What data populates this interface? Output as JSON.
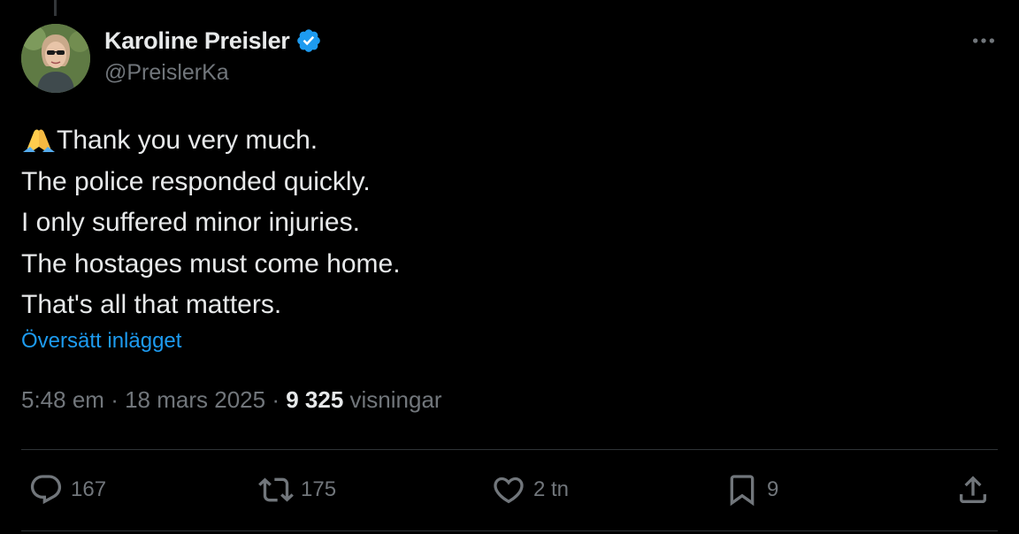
{
  "author": {
    "display_name": "Karoline Preisler",
    "handle": "@PreislerKa",
    "verified": true
  },
  "tweet": {
    "emoji": "folded-hands",
    "lines": [
      "Thank you very much.",
      "The police responded quickly.",
      "I only suffered minor injuries.",
      "The hostages must come home.",
      "That's all that matters."
    ],
    "translate_label": "Översätt inlägget"
  },
  "meta": {
    "time": "5:48 em",
    "separator": "·",
    "date": "18 mars 2025",
    "views_count": "9 325",
    "views_label": "visningar"
  },
  "actions": {
    "replies": "167",
    "reposts": "175",
    "likes": "2 tn",
    "bookmarks": "9"
  },
  "colors": {
    "background": "#000000",
    "text": "#e7e9ea",
    "secondary": "#71767b",
    "accent": "#1d9bf0",
    "divider": "#2f3336"
  },
  "icons": {
    "verified": "verified-badge-icon",
    "more": "more-options-icon",
    "reply": "reply-icon",
    "repost": "repost-icon",
    "like": "heart-icon",
    "bookmark": "bookmark-icon",
    "share": "share-icon"
  }
}
